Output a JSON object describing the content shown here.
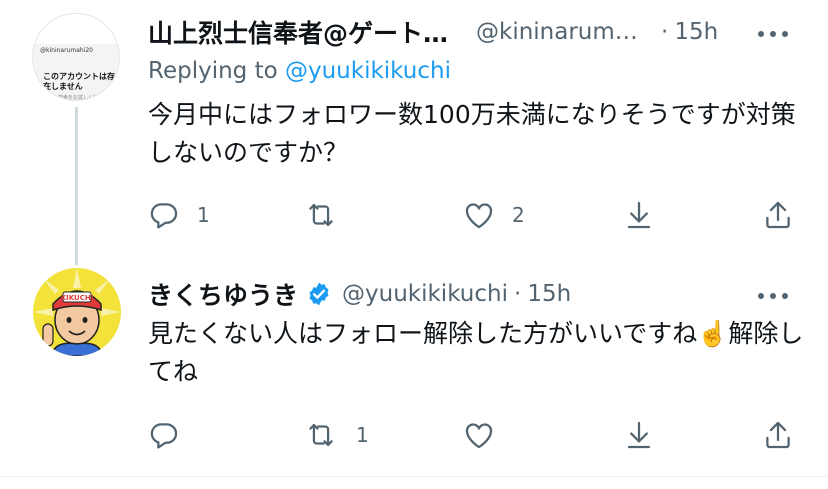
{
  "tweets": [
    {
      "name": "山上烈士信奉者@ゲート…",
      "handle": "@kininarum…",
      "separator": "·",
      "time": "15h",
      "replying_prefix": "Replying to ",
      "replying_handle": "@yuukikikuchi",
      "text": "今月中にはフォロワー数100万未満になりそうですが対策しないのですか？",
      "avatar": {
        "handle_line": "@kininarumahi20",
        "message": "このアカウントは存在しません",
        "sub": "ほかの検索をお試しください"
      },
      "reply_count": "1",
      "retweet_count": "",
      "like_count": "2"
    },
    {
      "name": "きくちゆうき",
      "handle": "@yuukikikuchi",
      "separator": "·",
      "time": "15h",
      "verified": true,
      "text": "見たくない人はフォロー解除した方がいいですね☝️解除してね",
      "avatar": {
        "cap_text": "KIKUCHI"
      },
      "reply_count": "",
      "retweet_count": "1",
      "like_count": ""
    }
  ],
  "icons": {
    "reply": "reply-icon",
    "retweet": "retweet-icon",
    "like": "heart-icon",
    "download": "download-icon",
    "share": "share-icon",
    "more": "more-icon",
    "verified": "verified-badge-icon"
  },
  "colors": {
    "text": "#0f1419",
    "secondary": "#536471",
    "link": "#1d9bf0",
    "verified": "#1d9bf0",
    "thread_line": "#cfd9de"
  }
}
